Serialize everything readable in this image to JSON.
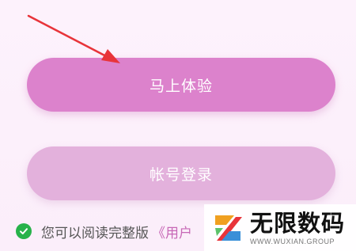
{
  "buttons": {
    "try_now_label": "马上体验",
    "account_login_label": "帐号登录"
  },
  "agreement": {
    "text": "您可以阅读完整版",
    "link": "《用户"
  },
  "watermark": {
    "brand": "无限数码",
    "site": "WWW.WUXIAN.GROUP"
  },
  "colors": {
    "primary_button": "#dc82cc",
    "secondary_button": "#e3b1dc",
    "check": "#27b24a",
    "arrow": "#e8343a",
    "link": "#c767b6"
  },
  "icons": {
    "agreement_check": "check-circle-icon",
    "annotation": "arrow-annotation"
  }
}
